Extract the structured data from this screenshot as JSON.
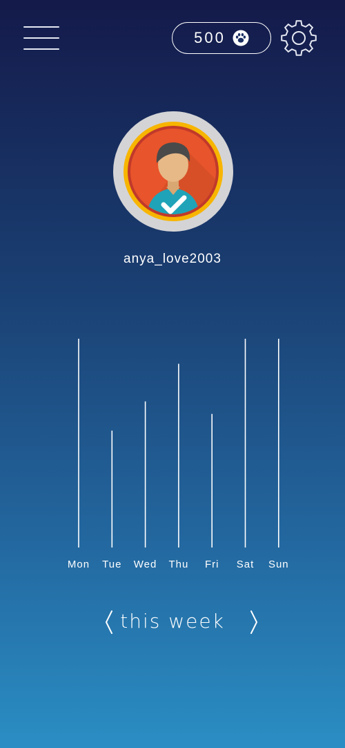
{
  "header": {
    "menu_icon": "hamburger-menu-icon",
    "coins": "500",
    "coin_icon": "paw-icon",
    "settings_icon": "gear-icon"
  },
  "profile": {
    "username": "anya_love2003",
    "avatar_icon": "verified-user-avatar-icon"
  },
  "chart_data": {
    "type": "bar",
    "categories": [
      "Mon",
      "Tue",
      "Wed",
      "Thu",
      "Fri",
      "Sat",
      "Sun"
    ],
    "values": [
      100,
      56,
      70,
      88,
      64,
      100,
      100
    ],
    "ylim": [
      0,
      100
    ],
    "grid": false,
    "color": "#ffffff"
  },
  "week_nav": {
    "label": "this week",
    "prev_icon": "chevron-left-icon",
    "next_icon": "chevron-right-icon"
  },
  "colors": {
    "background_top": "#141a4a",
    "background_bottom": "#2a8ec4",
    "avatar_ring": "#f7b500",
    "avatar_bg": "#e8542b",
    "check": "#ffffff"
  }
}
